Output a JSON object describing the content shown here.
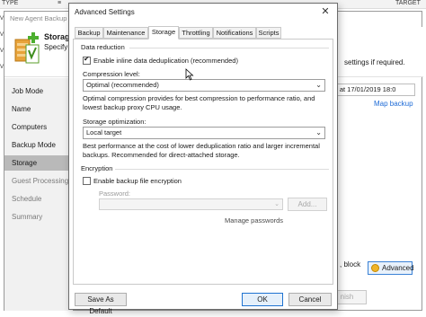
{
  "background": {
    "topbar_cols": [
      "TYPE",
      "TARGET"
    ],
    "wizard_title": "New Agent Backup",
    "header_title": "Storage",
    "header_subtitle": "Specify b",
    "header_right": "settings if required.",
    "nav": [
      {
        "label": "Job Mode"
      },
      {
        "label": "Name"
      },
      {
        "label": "Computers"
      },
      {
        "label": "Backup Mode"
      },
      {
        "label": "Storage"
      },
      {
        "label": "Guest Processing"
      },
      {
        "label": "Schedule"
      },
      {
        "label": "Summary"
      }
    ],
    "schedule_field": "tor at 17/01/2019 18:0",
    "map_backup_link": "Map backup",
    "block_text": ", block",
    "advanced_button": "Advanced",
    "finish_button": "nish"
  },
  "dialog": {
    "title": "Advanced Settings",
    "close_glyph": "✕",
    "tabs": [
      "Backup",
      "Maintenance",
      "Storage",
      "Throttling",
      "Notifications",
      "Scripts"
    ],
    "active_tab": "Storage",
    "data_reduction": {
      "label": "Data reduction",
      "dedup_label": "Enable inline data deduplication (recommended)",
      "dedup_checked": true,
      "compression_label": "Compression level:",
      "compression_value": "Optimal (recommended)",
      "compression_desc_1": "Optimal compression provides for best compression to performance ratio, and",
      "compression_desc_2": "lowest backup proxy CPU usage.",
      "storage_opt_label": "Storage optimization:",
      "storage_opt_value": "Local target",
      "storage_desc_1": "Best performance at the cost of lower deduplication ratio and larger incremental",
      "storage_desc_2": "backups. Recommended for direct-attached storage."
    },
    "encryption": {
      "label": "Encryption",
      "enable_label": "Enable backup file encryption",
      "enable_checked": false,
      "password_label": "Password:",
      "add_button": "Add...",
      "manage_passwords": "Manage passwords"
    },
    "footer": {
      "save_default": "Save As Default",
      "ok": "OK",
      "cancel": "Cancel"
    }
  }
}
